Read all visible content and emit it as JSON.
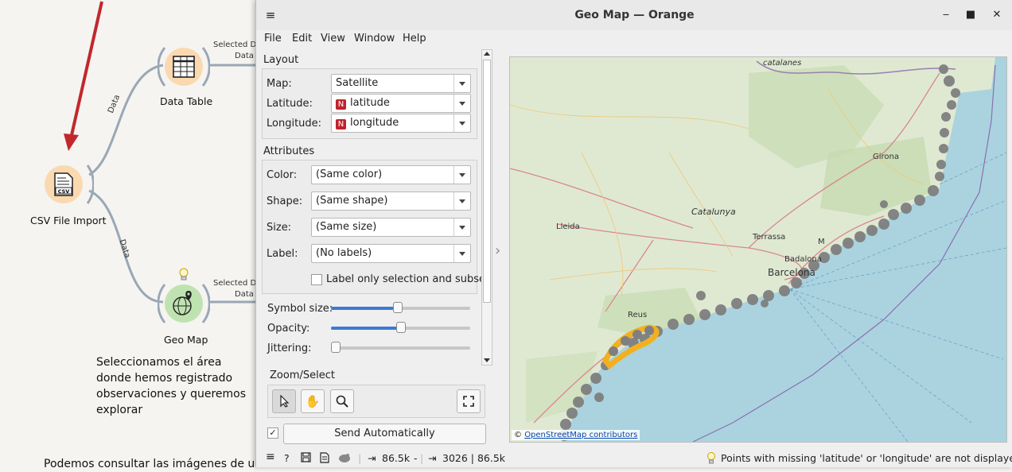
{
  "canvas": {
    "nodes": {
      "data_table": {
        "label": "Data Table"
      },
      "csv_import": {
        "label": "CSV File Import"
      },
      "geo_map": {
        "label": "Geo Map"
      }
    },
    "edges": {
      "e1": {
        "label": "Data"
      },
      "e2": {
        "label": "Data"
      },
      "out1": {
        "label_line1": "Selected Da",
        "label_line2": "Data"
      },
      "out2": {
        "label_line1": "Selected Da",
        "label_line2": "Data"
      }
    },
    "note_lines": [
      "Seleccionamos el área",
      "donde hemos registrado",
      "observaciones y queremos",
      "explorar"
    ],
    "bottom_text": "Podemos consultar las imágenes de una",
    "icons": {
      "data_table": "table-icon",
      "csv": "csv-file-icon",
      "geo_map": "globe-pin-icon",
      "lightbulb": "lightbulb-icon",
      "arrow": "red-arrow"
    },
    "colors": {
      "node_orange": "#fbd9b0",
      "node_green": "#bfe3b0",
      "arrow_red": "#c0282d"
    }
  },
  "window": {
    "title": "Geo Map — Orange",
    "menu": [
      "File",
      "Edit",
      "View",
      "Window",
      "Help"
    ],
    "layout": {
      "title": "Layout",
      "map_label": "Map:",
      "map_value": "Satellite",
      "lat_label": "Latitude:",
      "lat_value": "latitude",
      "lon_label": "Longitude:",
      "lon_value": "longitude",
      "badge": "N"
    },
    "attributes": {
      "title": "Attributes",
      "color_label": "Color:",
      "color_value": "(Same color)",
      "shape_label": "Shape:",
      "shape_value": "(Same shape)",
      "size_label": "Size:",
      "size_value": "(Same size)",
      "label_label": "Label:",
      "label_value": "(No labels)",
      "checkbox_label": "Label only selection and subset"
    },
    "sliders": {
      "symbol_size_label": "Symbol size:",
      "symbol_size": 0.48,
      "opacity_label": "Opacity:",
      "opacity": 0.5,
      "jittering_label": "Jittering:",
      "jittering": 0.0
    },
    "zoom": {
      "title": "Zoom/Select"
    },
    "send_button": "Send Automatically",
    "status": {
      "input": "86.5k",
      "input_sep": "-",
      "output": "3026 | 86.5k",
      "message": "Points with missing 'latitude' or 'longitude' are not displayed"
    },
    "map": {
      "places": {
        "catalanes": "catalanes",
        "girona": "Girona",
        "catalunya": "Catalunya",
        "lleida": "Lleida",
        "terrassa": "Terrassa",
        "m": "M",
        "badalona": "Badalona",
        "barcelona": "Barcelona",
        "reus": "Reus"
      },
      "attribution_prefix": "©",
      "attribution_link": "OpenStreetMap contributors"
    }
  }
}
